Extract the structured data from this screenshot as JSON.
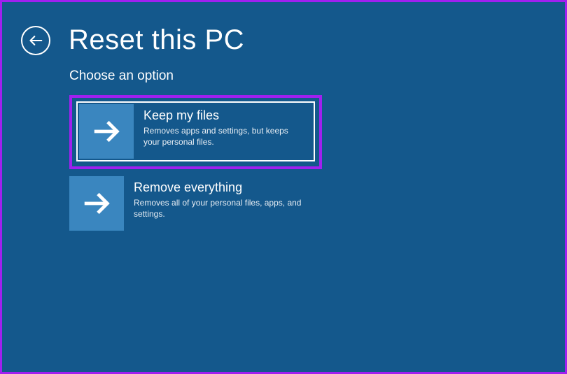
{
  "header": {
    "title": "Reset this PC"
  },
  "subtitle": "Choose an option",
  "options": [
    {
      "title": "Keep my files",
      "description": "Removes apps and settings, but keeps your personal files."
    },
    {
      "title": "Remove everything",
      "description": "Removes all of your personal files, apps, and settings."
    }
  ]
}
